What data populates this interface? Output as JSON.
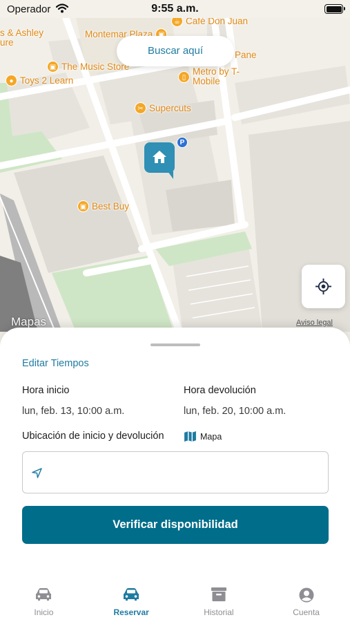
{
  "status_bar": {
    "carrier": "Operador",
    "time": "9:55 a.m."
  },
  "map": {
    "search_here_label": "Buscar aquí",
    "attribution": "Mapas",
    "legal_label": "Aviso legal",
    "parking_badge": "P",
    "pois": [
      {
        "name": "Café Don Juan"
      },
      {
        "name": "s & Ashley"
      },
      {
        "name": "ure"
      },
      {
        "name": "Montemar Plaza"
      },
      {
        "name": "Pane"
      },
      {
        "name": "The Music Store"
      },
      {
        "name": "Metro by T-Mobile"
      },
      {
        "name": "Toys 2 Learn"
      },
      {
        "name": "Supercuts"
      },
      {
        "name": "Best Buy"
      }
    ]
  },
  "sheet": {
    "edit_times": "Editar Tiempos",
    "start_label": "Hora inicio",
    "start_value": "lun, feb. 13, 10:00 a.m.",
    "return_label": "Hora devolución",
    "return_value": "lun, feb. 20, 10:00 a.m.",
    "location_label": "Ubicación de inicio y devolución",
    "map_link": "Mapa",
    "location_input_value": "",
    "check_button": "Verificar disponibilidad"
  },
  "tabs": [
    {
      "label": "Inicio",
      "icon": "car-icon"
    },
    {
      "label": "Reservar",
      "icon": "car-icon",
      "active": true
    },
    {
      "label": "Historial",
      "icon": "archive-icon"
    },
    {
      "label": "Cuenta",
      "icon": "person-circle-icon"
    }
  ],
  "colors": {
    "accent": "#1f7ba2",
    "primary_button": "#006d8a",
    "marker": "#2f8fb5",
    "poi": "#e08a16"
  }
}
